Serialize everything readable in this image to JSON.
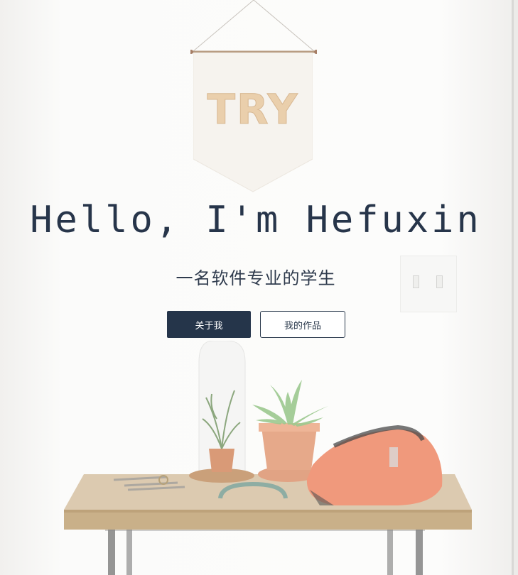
{
  "hero": {
    "pennant_text": "TRY",
    "headline": "Hello, I'm Hefuxin",
    "subtitle": "一名软件专业的学生",
    "buttons": {
      "about_label": "关于我",
      "works_label": "我的作品"
    }
  },
  "colors": {
    "primary": "#25354a",
    "text": "#27354a",
    "background": "#fcfcfb"
  }
}
